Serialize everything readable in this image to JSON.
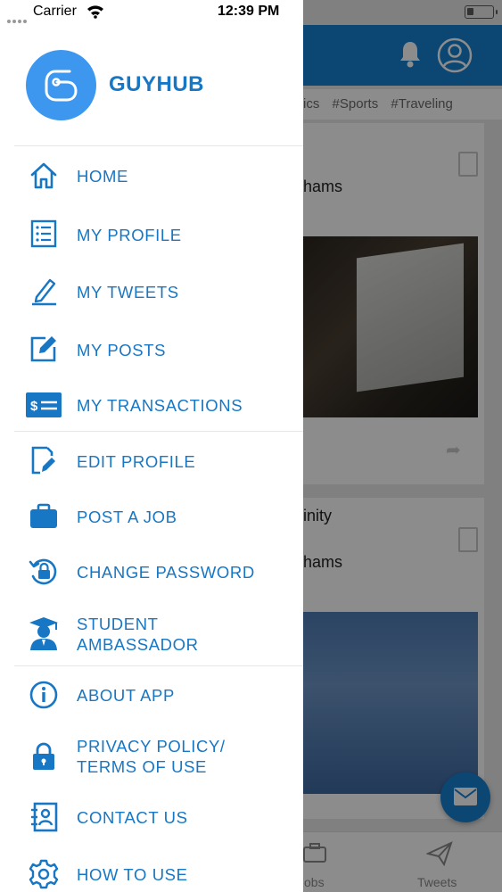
{
  "status_bar": {
    "carrier": "Carrier",
    "time": "12:39 PM"
  },
  "drawer": {
    "brand": "GUYHUB",
    "menu": [
      {
        "label": "HOME",
        "icon": "home-icon"
      },
      {
        "label": "MY PROFILE",
        "icon": "profile-list-icon"
      },
      {
        "label": "MY TWEETS",
        "icon": "pen-icon"
      },
      {
        "label": "MY POSTS",
        "icon": "edit-square-icon"
      },
      {
        "label": "MY TRANSACTIONS",
        "icon": "money-card-icon"
      },
      {
        "label": "EDIT PROFILE",
        "icon": "edit-document-icon"
      },
      {
        "label": "POST A JOB",
        "icon": "briefcase-icon"
      },
      {
        "label": "CHANGE PASSWORD",
        "icon": "lock-reset-icon"
      },
      {
        "label_line1": "STUDENT",
        "label_line2": "AMBASSADOR",
        "icon": "graduate-icon"
      },
      {
        "label": "ABOUT APP",
        "icon": "info-icon"
      },
      {
        "label_line1": "PRIVACY POLICY/",
        "label_line2": "TERMS OF USE",
        "icon": "lock-icon"
      },
      {
        "label": "CONTACT US",
        "icon": "contact-book-icon"
      },
      {
        "label": "HOW TO USE",
        "icon": "gear-icon"
      }
    ]
  },
  "background": {
    "tags": [
      "ics",
      "#Sports",
      "#Traveling"
    ],
    "card1_text": "hams",
    "card2_title": "inity",
    "card2_text": "hams",
    "tab_jobs": "Jobs",
    "tab_tweets": "Tweets"
  },
  "colors": {
    "accent": "#1877c4",
    "appbar": "#1682d4",
    "logo_bg": "#3d97ef"
  }
}
